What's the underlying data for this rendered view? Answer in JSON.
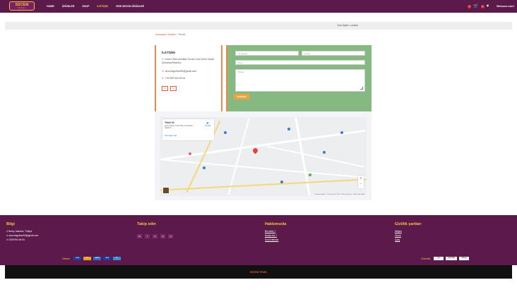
{
  "nav": {
    "logo_text": "SİZCEM",
    "logo_sub": "TEKEL",
    "links": [
      "HOME",
      "ÜRÜNLER",
      "SHOP",
      "İLETİŞİM",
      "YENİ SEZON ÜRÜNLER"
    ],
    "active_index": 3,
    "cart_count": "0",
    "fav_count": "0",
    "welcome": "Welcome user!"
  },
  "breadcrumb_bar": {
    "text": "Ana Sayfa / contact"
  },
  "crumbs": {
    "home": "Anasayfa",
    "sep": " / ",
    "page": "İletişim",
    "current": "Teknik"
  },
  "contact_info": {
    "title": "İLETİŞİM",
    "address": "Hızırcı Mah.Utustifan Sıcam Cad.Cenel Sokak Ümraniye/İstanbul",
    "email": "sizcemtgulhan93@gmail.com",
    "phone": "+90 999 994 69 54",
    "social": [
      "fb",
      "ig"
    ]
  },
  "form": {
    "name_placeholder": "Ad Soyad",
    "email_placeholder": "Email",
    "subject_placeholder": "Konu",
    "message_placeholder": "Mesaj",
    "send_label": "GÖNDER"
  },
  "map": {
    "place_name": "Tekel 01",
    "place_address": "Hızırcı Mah. Cenel Sok. Ümraniye/İstanbul",
    "place_link": "View larger map",
    "directions": "Yol tarifi",
    "attribution": "Klavye kısayolları · Harita verileri ©2024 · Kullanım Şartları · Harita hatası bildir"
  },
  "footer": {
    "bilgi": {
      "title": "Bilgi",
      "address": "Berey, İstanbul, Türkiye",
      "email": "sizcemtgulhan93@gmail.com",
      "phone": "0209 994 69 54"
    },
    "takip": {
      "title": "Takip edin",
      "icons": [
        "tw",
        "f",
        "in",
        "ig",
        "yt"
      ]
    },
    "hakkimizda": {
      "title": "Hakkımızda",
      "links": [
        "Biz kimiz ?",
        "Neden biz ?",
        "Son Erteleme"
      ]
    },
    "gizlilik": {
      "title": "Gizlilik şartları",
      "links": [
        "İletişim",
        "Önerir",
        "Çalış"
      ]
    },
    "payment_label": "Ödeme",
    "cards": [
      "VISA",
      "MC",
      "AMEX",
      "VISA",
      "PP"
    ],
    "security_label": "Güvenlik",
    "security_badges": [
      "SSL",
      "SECURE",
      "256-bit"
    ],
    "copyright": "SİZCEM TEKEL"
  }
}
